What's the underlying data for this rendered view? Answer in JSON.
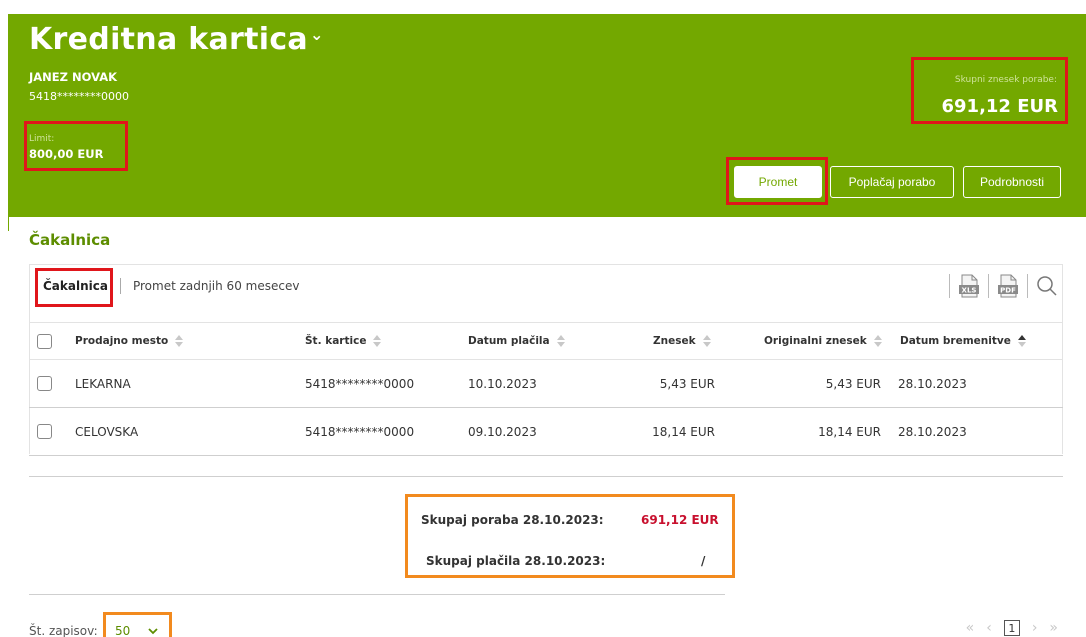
{
  "header": {
    "title": "Kreditna kartica",
    "title_chevron": "⌄",
    "holder_name": "JANEZ NOVAK",
    "card_number": "5418********0000",
    "limit_label": "Limit:",
    "limit_value": "800,00 EUR",
    "total_label": "Skupni znesek porabe:",
    "total_value": "691,12 EUR",
    "buttons": [
      {
        "label": "Promet",
        "active": true
      },
      {
        "label": "Poplačaj porabo",
        "active": false
      },
      {
        "label": "Podrobnosti",
        "active": false
      }
    ]
  },
  "section_title": "Čakalnica",
  "tabs": {
    "active": "Čakalnica",
    "other": "Promet zadnjih 60 mesecev"
  },
  "toolbar": {
    "xls_label": "XLS",
    "pdf_label": "PDF",
    "search_icon": "search-icon"
  },
  "table": {
    "columns": [
      "Prodajno mesto",
      "Št. kartice",
      "Datum plačila",
      "Znesek",
      "Originalni znesek",
      "Datum bremenitve"
    ],
    "rows": [
      {
        "merchant": "LEKARNA",
        "card": "5418********0000",
        "date": "10.10.2023",
        "amount": "5,43 EUR",
        "original": "5,43 EUR",
        "charge_date": "28.10.2023"
      },
      {
        "merchant": "CELOVSKA",
        "card": "5418********0000",
        "date": "09.10.2023",
        "amount": "18,14 EUR",
        "original": "18,14 EUR",
        "charge_date": "28.10.2023"
      }
    ]
  },
  "summary": {
    "spending_label": "Skupaj poraba 28.10.2023:",
    "spending_value": "691,12 EUR",
    "payments_label": "Skupaj plačila 28.10.2023:",
    "payments_value": "/",
    "accent_color": "#c8102e"
  },
  "footer": {
    "per_page_label": "Št. zapisov:",
    "per_page_value": "50",
    "current_page": "1"
  },
  "colors": {
    "brand_green": "#73a800",
    "highlight_red": "#e0161b",
    "highlight_orange": "#f28a1e"
  }
}
